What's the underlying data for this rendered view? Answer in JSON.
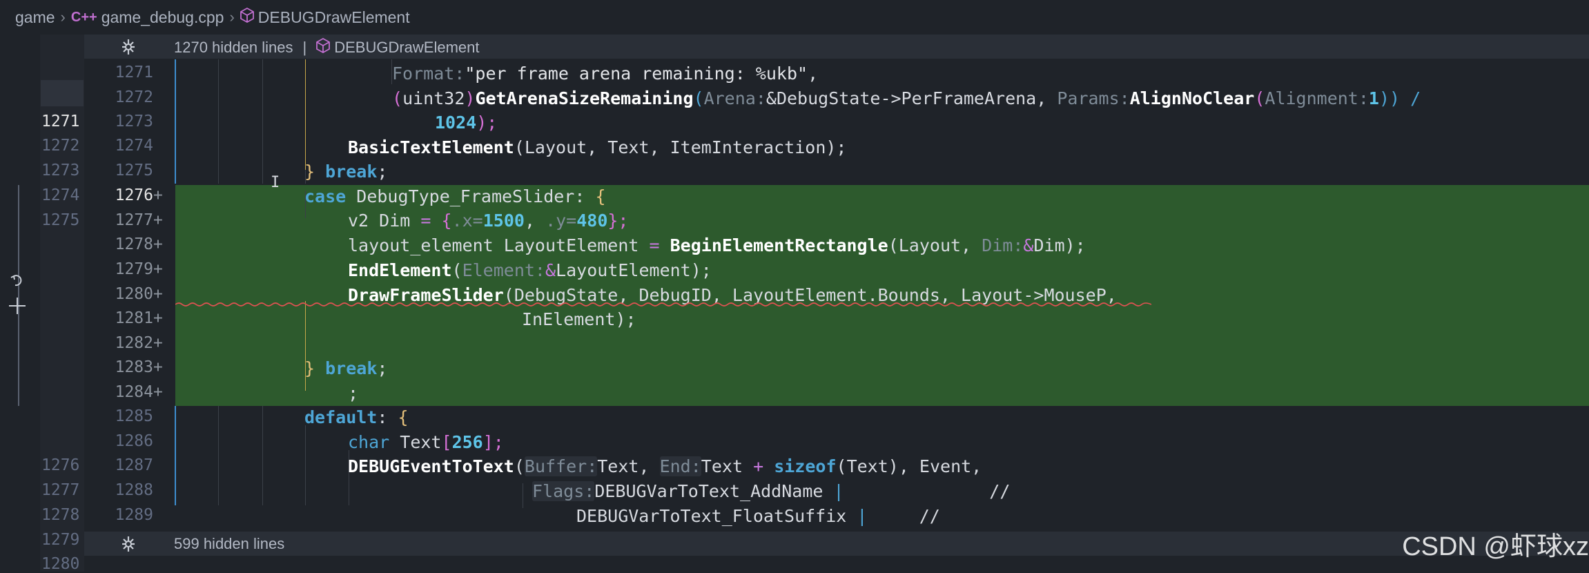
{
  "breadcrumb": {
    "root": "game",
    "file": "game_debug.cpp",
    "file_icon": "C++",
    "symbol": "DEBUGDrawElement"
  },
  "fold_top": {
    "text": "1270 hidden lines",
    "separator": "|",
    "symbol": "DEBUGDrawElement"
  },
  "fold_bottom": {
    "text": "599 hidden lines"
  },
  "old_line_numbers": [
    "1271",
    "1272",
    "1273",
    "1274",
    "1275",
    "1276",
    "1277",
    "1278",
    "1279",
    "1280"
  ],
  "new_line_numbers": [
    "1271",
    "1272",
    "1273",
    "1274",
    "1275",
    "1276",
    "1277",
    "1278",
    "1279",
    "1280",
    "1281",
    "1282",
    "1283",
    "1284",
    "1285",
    "1286",
    "1287",
    "1288",
    "1289"
  ],
  "added_marker": "+",
  "code": {
    "l1271_hint": "Format:",
    "l1271_str": "\"per frame arena remaining: %ukb\"",
    "l1271_comma": ",",
    "l1272_open": "(",
    "l1272_type": "uint32",
    "l1272_close": ")",
    "l1272_fn": "GetArenaSizeRemaining",
    "l1272_hint1": "Arena:",
    "l1272_arg1": "&DebugState->PerFrameArena,",
    "l1272_hint2": "Params:",
    "l1272_fn2": "AlignNoClear",
    "l1272_hint3": "Alignment:",
    "l1272_num": "1",
    "l1272_tail": "))",
    "l1272_div": "/",
    "l1273_num": "1024",
    "l1273_tail": ");",
    "l1274_fn": "BasicTextElement",
    "l1274_args": "(Layout, Text, ItemInteraction);",
    "l1275_brace": "}",
    "l1275_kw": "break",
    "l1275_semi": ";",
    "l1276_kw": "case",
    "l1276_label": "DebugType_FrameSlider:",
    "l1276_brace": "{",
    "l1277_type": "v2 Dim",
    "l1277_eq": "=",
    "l1277_open": "{",
    "l1277_x": ".x=",
    "l1277_xv": "1500",
    "l1277_comma": ",",
    "l1277_y": ".y=",
    "l1277_yv": "480",
    "l1277_close": "};",
    "l1278_decl": "layout_element LayoutElement",
    "l1278_eq": "=",
    "l1278_fn": "BeginElementRectangle",
    "l1278_args1": "(Layout,",
    "l1278_hint": "Dim:",
    "l1278_amp": "&",
    "l1278_args2": "Dim);",
    "l1279_fn": "EndElement",
    "l1279_open": "(",
    "l1279_hint": "Element:",
    "l1279_amp": "&",
    "l1279_arg": "LayoutElement);",
    "l1280_fn": "DrawFrameSlider",
    "l1280_args": "(DebugState, DebugID, LayoutElement.Bounds, Layout->MouseP,",
    "l1281_args": "InElement);",
    "l1283_brace": "}",
    "l1283_kw": "break",
    "l1283_semi": ";",
    "l1284_semi": ";",
    "l1285_kw": "default",
    "l1285_colon": ":",
    "l1285_brace": "{",
    "l1286_kw": "char",
    "l1286_decl": "Text",
    "l1286_open": "[",
    "l1286_num": "256",
    "l1286_close": "];",
    "l1287_fn": "DEBUGEventToText",
    "l1287_open": "(",
    "l1287_hint1": "Buffer:",
    "l1287_arg1": "Text,",
    "l1287_hint2": "End:",
    "l1287_arg2": "Text",
    "l1287_plus": "+",
    "l1287_kw": "sizeof",
    "l1287_arg3": "(Text), Event,",
    "l1288_hint": "Flags:",
    "l1288_arg": "DEBUGVarToText_AddName",
    "l1288_pipe": "|",
    "l1288_com": "//",
    "l1289_arg": "DEBUGVarToText_FloatSuffix",
    "l1289_pipe": "|",
    "l1289_com": "//"
  },
  "watermark": "CSDN @虾球xz",
  "colors": {
    "editor_bg": "#1f2329",
    "added_bg": "#2d5a2d",
    "keyword": "#4ea6d6",
    "number": "#5ec4e8",
    "brace": "#e5c07b",
    "bracket": "#d670d6"
  }
}
